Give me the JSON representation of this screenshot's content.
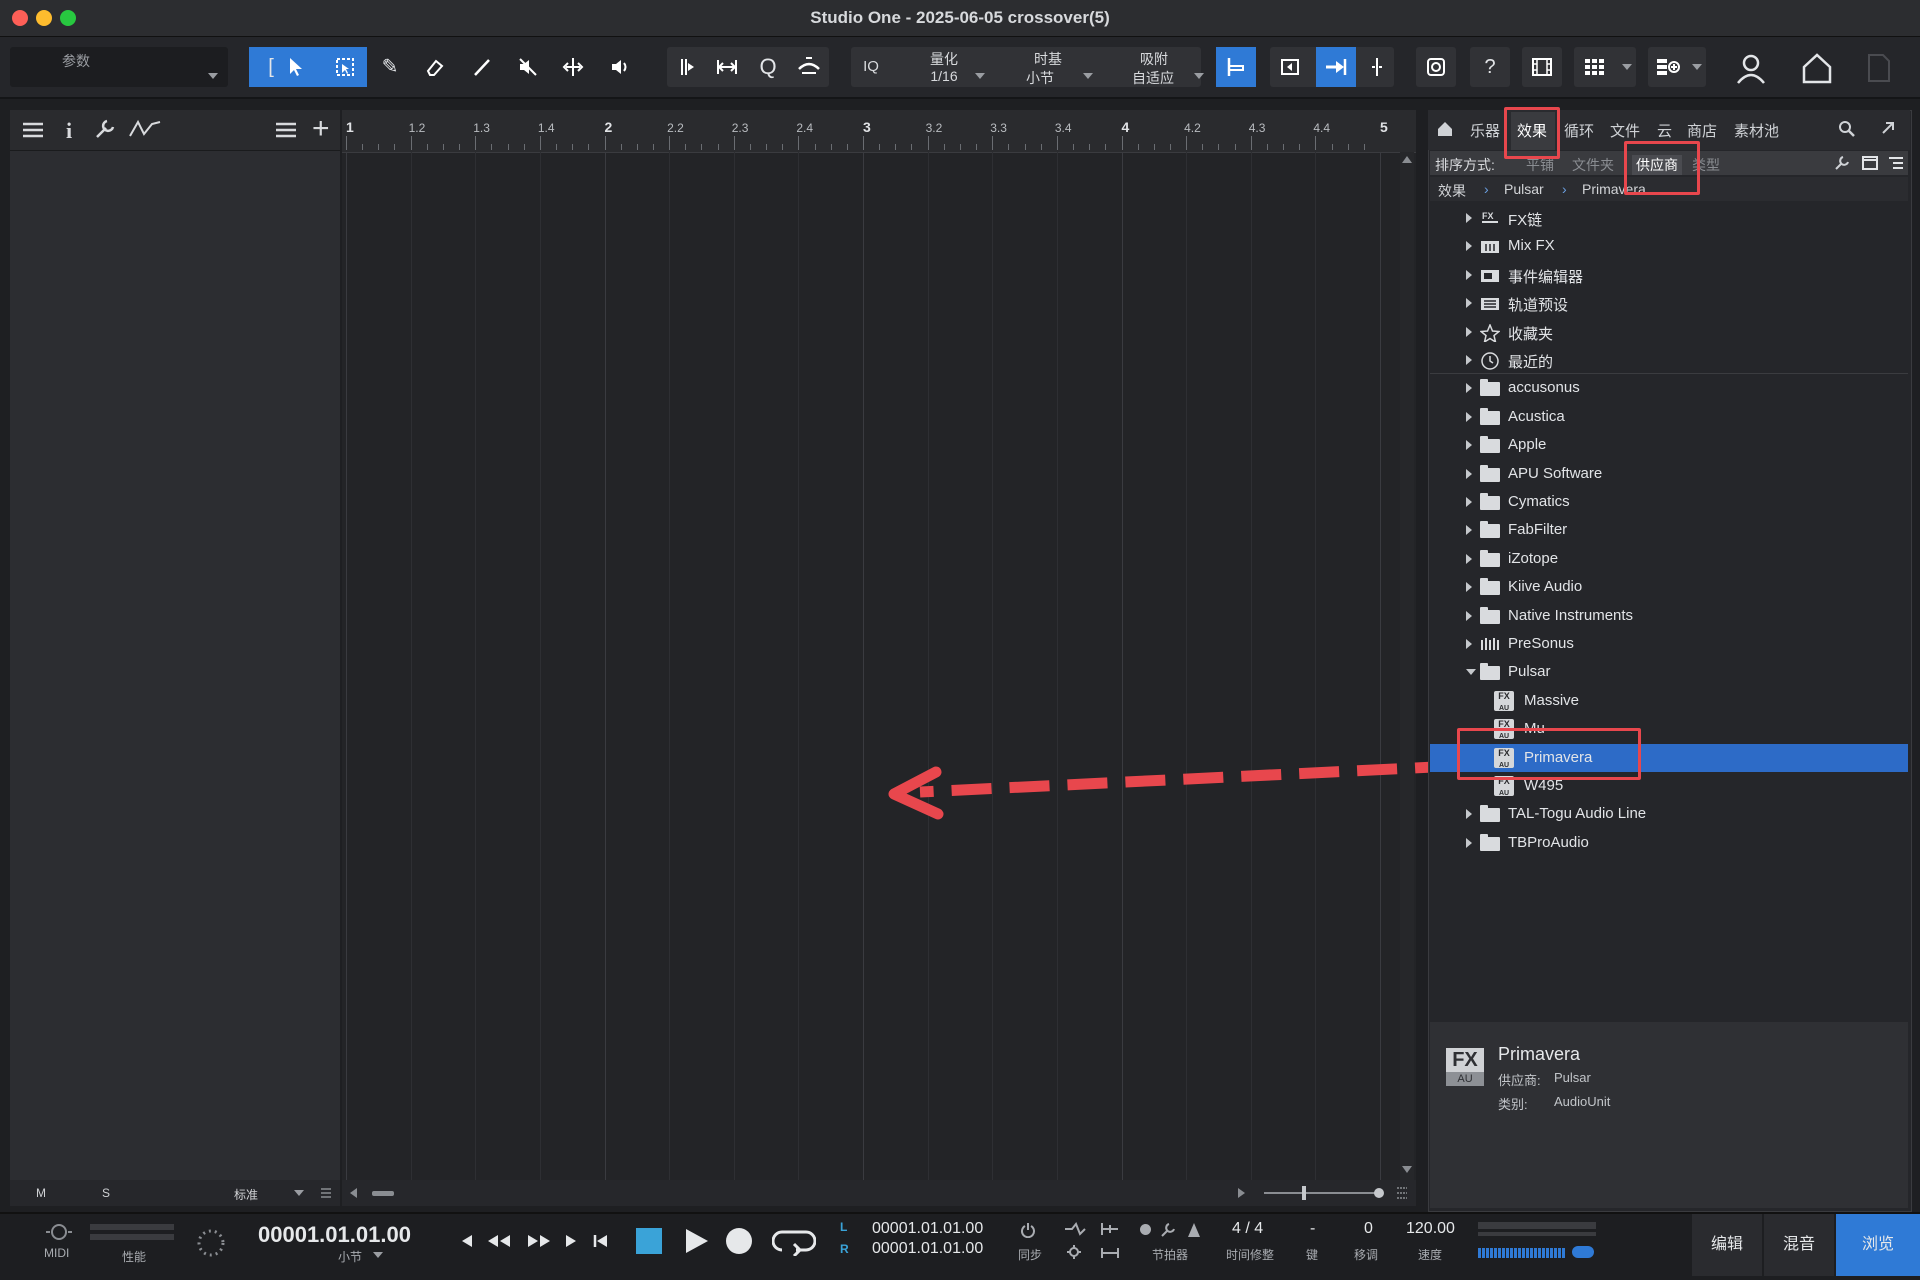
{
  "window": {
    "title": "Studio One - 2025-06-05 crossover(5)"
  },
  "toolbar": {
    "params_label": "参数",
    "iq_label": "IQ",
    "quantize": {
      "label": "量化",
      "value": "1/16"
    },
    "timebase": {
      "label": "时基",
      "value": "小节"
    },
    "snap": {
      "label": "吸附",
      "value": "自适应"
    },
    "help_label": "?"
  },
  "ruler": {
    "labels": [
      "1",
      "1.2",
      "1.3",
      "1.4",
      "2",
      "2.2",
      "2.3",
      "2.4",
      "3",
      "3.2",
      "3.3",
      "3.4",
      "4",
      "4.2",
      "4.3",
      "4.4",
      "5"
    ]
  },
  "inspector_footer": {
    "m": "M",
    "s": "S",
    "mode": "标准"
  },
  "browser": {
    "tabs": [
      "乐器",
      "效果",
      "循环",
      "文件",
      "云",
      "商店",
      "素材池"
    ],
    "active_tab": "效果",
    "sort": {
      "label": "排序方式:",
      "options": [
        "平铺",
        "文件夹",
        "供应商",
        "类型"
      ],
      "active": "供应商"
    },
    "path": [
      "效果",
      "Pulsar",
      "Primavera"
    ],
    "items": [
      {
        "label": "FX链",
        "icon": "fx-chain-icon"
      },
      {
        "label": "Mix FX",
        "icon": "mixfx-icon"
      },
      {
        "label": "事件编辑器",
        "icon": "event-editor-icon"
      },
      {
        "label": "轨道预设",
        "icon": "track-preset-icon"
      },
      {
        "label": "收藏夹",
        "icon": "star-icon"
      },
      {
        "label": "最近的",
        "icon": "clock-icon"
      }
    ],
    "vendors": [
      "accusonus",
      "Acustica",
      "Apple",
      "APU Software",
      "Cymatics",
      "FabFilter",
      "iZotope",
      "Kiive Audio",
      "Native Instruments",
      "PreSonus",
      "Pulsar"
    ],
    "pulsar_children": [
      "Massive",
      "Mu",
      "Primavera",
      "W495"
    ],
    "selected": "Primavera",
    "vendors_after": [
      "TAL-Togu Audio Line",
      "TBProAudio"
    ],
    "info": {
      "badge_top": "FX",
      "badge_bottom": "AU",
      "name": "Primavera",
      "vendor_label": "供应商:",
      "vendor_value": "Pulsar",
      "category_label": "类别:",
      "category_value": "AudioUnit"
    }
  },
  "transport": {
    "midi_label": "MIDI",
    "perf_label": "性能",
    "position": "00001.01.01.00",
    "position_unit": "小节",
    "loop_l_label": "L",
    "loop_r_label": "R",
    "loop_start": "00001.01.01.00",
    "loop_end": "00001.01.01.00",
    "sync_label": "同步",
    "metronome_label": "节拍器",
    "signature": "4 / 4",
    "signature_label": "时间修整",
    "key_value": "-",
    "key_label": "键",
    "transpose_value": "0",
    "transpose_label": "移调",
    "tempo": "120.00",
    "tempo_label": "速度"
  },
  "nav": {
    "edit": "编辑",
    "mix": "混音",
    "browse": "浏览",
    "active": "浏览"
  },
  "colors": {
    "accent": "#2f7ad6",
    "highlight_red": "#e8474d",
    "selected_row": "#2d6bc7"
  }
}
